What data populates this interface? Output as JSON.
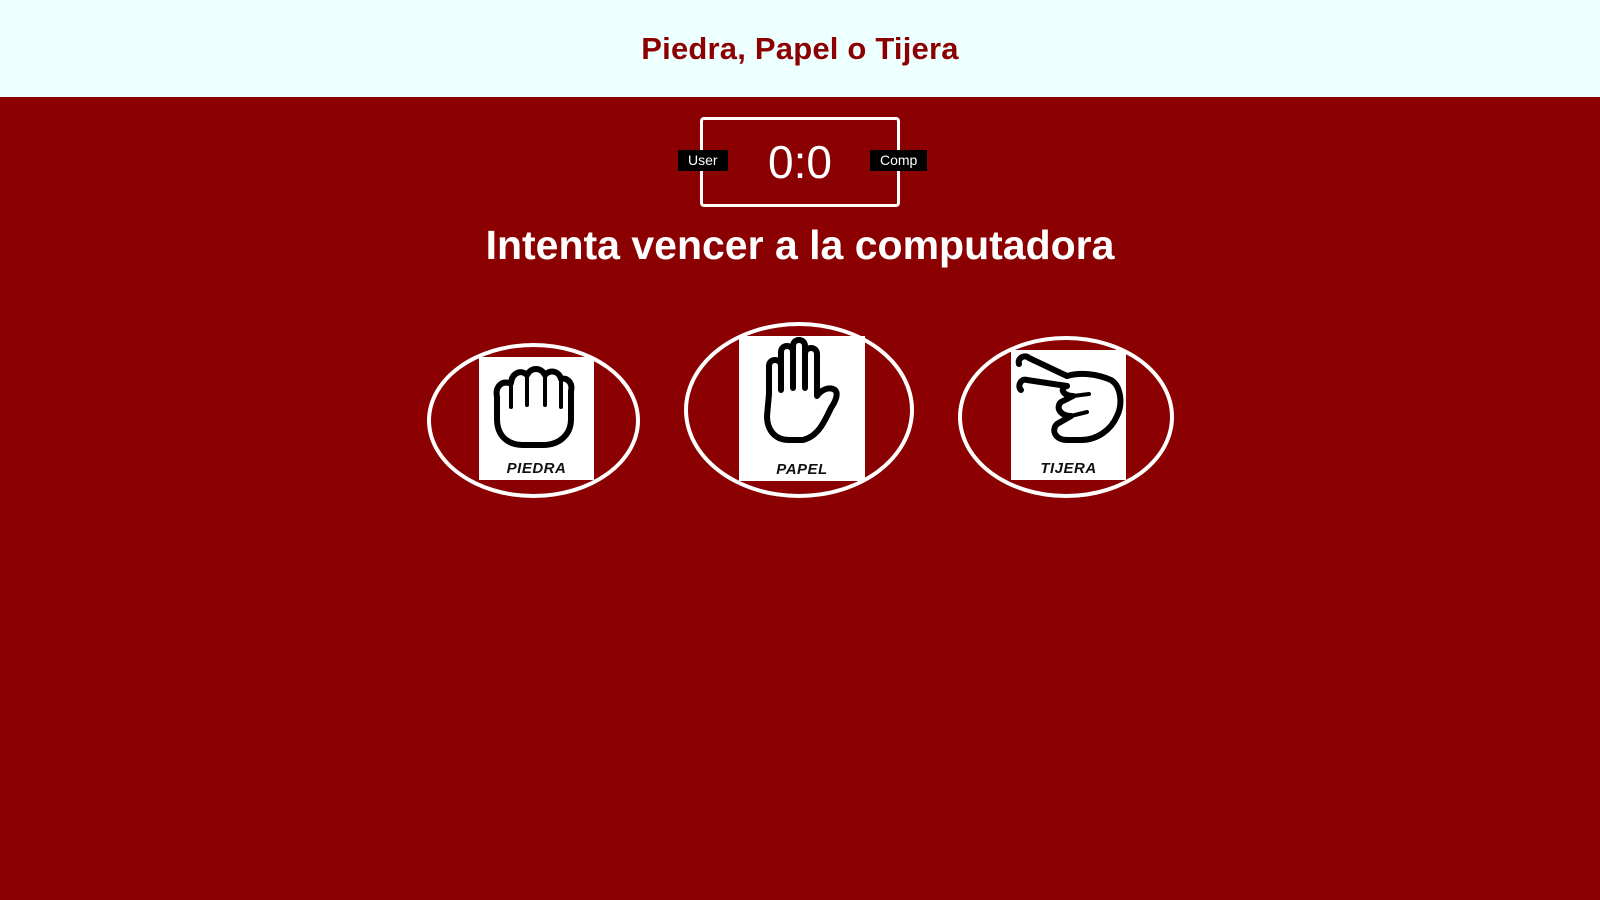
{
  "header": {
    "title": "Piedra, Papel o Tijera"
  },
  "scoreboard": {
    "user_label": "User",
    "comp_label": "Comp",
    "score": "0:0"
  },
  "message": "Intenta vencer a la computadora",
  "choices": [
    {
      "id": "piedra",
      "label": "PIEDRA",
      "icon": "fist-icon"
    },
    {
      "id": "papel",
      "label": "PAPEL",
      "icon": "open-hand-icon"
    },
    {
      "id": "tijera",
      "label": "TIJERA",
      "icon": "scissors-hand-icon"
    }
  ],
  "colors": {
    "background": "#8b0000",
    "header_background": "#eeffff",
    "title": "#8b0000",
    "badge": "#000000",
    "text": "#ffffff"
  }
}
